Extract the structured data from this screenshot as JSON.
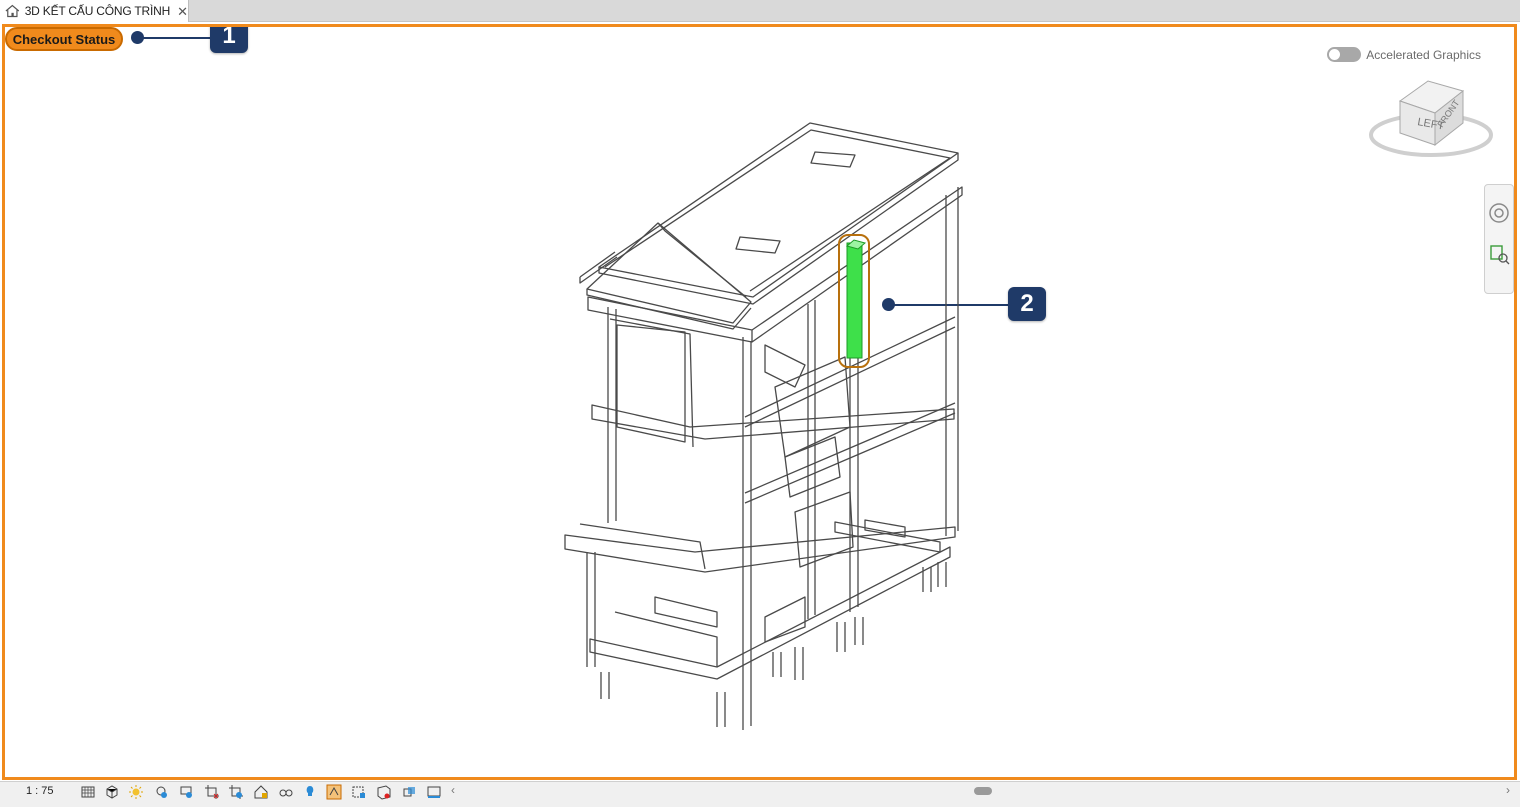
{
  "tab": {
    "title": "3D KẾT CẤU CÔNG TRÌNH",
    "close_glyph": "✕",
    "icon": "home-icon"
  },
  "viewport": {
    "checkout_label": "Checkout Status",
    "accelerated_graphics_label": "Accelerated Graphics",
    "accelerated_graphics_on": false,
    "highlight_color": "#3ee04a",
    "frame_color": "#f08a1c"
  },
  "callouts": [
    {
      "number": "1"
    },
    {
      "number": "2"
    }
  ],
  "viewcube": {
    "left_face": "LEFT",
    "front_face": "FRONT"
  },
  "statusbar": {
    "scale": "1 : 75",
    "icons": [
      "detail-level-icon",
      "visual-style-icon",
      "sun-path-icon",
      "shadows-icon",
      "render-icon",
      "crop-view-icon",
      "show-crop-region-icon",
      "unlock-3d-view-icon",
      "temporary-hide-icon",
      "reveal-hidden-icon",
      "worksharing-display-icon",
      "temporary-view-properties-icon",
      "show-analytical-model-icon",
      "highlight-displacement-icon",
      "reveal-constraints-icon"
    ]
  }
}
